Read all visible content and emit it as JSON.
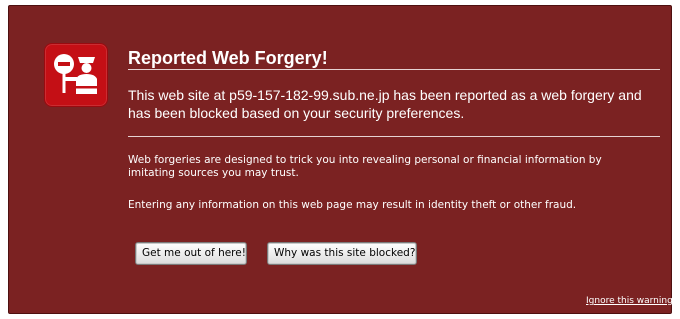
{
  "warning": {
    "icon": "forgery-officer-icon",
    "title": "Reported Web Forgery!",
    "main_message": "This web site at p59-157-182-99.sub.ne.jp has been reported as a web forgery and has been blocked based on your security preferences.",
    "info_paragraphs": [
      "Web forgeries are designed to trick you into revealing personal or financial information by imitating sources you may trust.",
      "Entering any information on this web page may result in identity theft or other fraud."
    ]
  },
  "buttons": {
    "get_out_label": "Get me out of here!",
    "why_blocked_label": "Why was this site blocked?"
  },
  "ignore_link": "Ignore this warning",
  "colors": {
    "panel_background": "#7b2222",
    "icon_badge": "#c40f15",
    "text": "#ffffff"
  }
}
